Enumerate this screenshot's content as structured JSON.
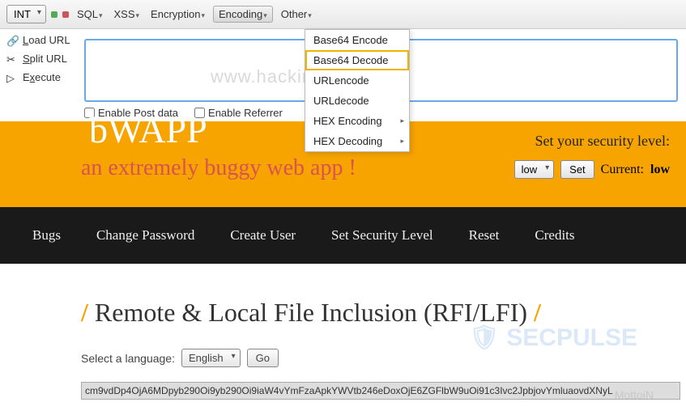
{
  "toolbar": {
    "int_label": "INT",
    "items": [
      "SQL",
      "XSS",
      "Encryption",
      "Encoding",
      "Other"
    ]
  },
  "encoding_menu": {
    "items": [
      {
        "label": "Base64 Encode",
        "submenu": false
      },
      {
        "label": "Base64 Decode",
        "submenu": false,
        "highlight": true
      },
      {
        "label": "URLencode",
        "submenu": false
      },
      {
        "label": "URLdecode",
        "submenu": false
      },
      {
        "label": "HEX Encoding",
        "submenu": true
      },
      {
        "label": "HEX Decoding",
        "submenu": true
      }
    ]
  },
  "side": {
    "load": "Load URL",
    "split": "Split URL",
    "execute": "Execute"
  },
  "checks": {
    "post": "Enable Post data",
    "referrer": "Enable Referrer"
  },
  "watermark": "www.hackingarticles.in",
  "banner": {
    "title": "bWAPP",
    "subtitle": "an extremely buggy web app !",
    "sec_label": "Set your security level:",
    "level_value": "low",
    "set_btn": "Set",
    "current_label": "Current:",
    "current_value": "low"
  },
  "nav": [
    "Bugs",
    "Change Password",
    "Create User",
    "Set Security Level",
    "Reset",
    "Credits"
  ],
  "page": {
    "title": "Remote & Local File Inclusion (RFI/LFI)",
    "lang_label": "Select a language:",
    "lang_value": "English",
    "go": "Go",
    "encoded": "cm9vdDp4OjA6MDpyb290Oi9yb290Oi9iaW4vYmFzaApkYWVtb246eDoxOjE6ZGFlbW9uOi91c3Ivc2JpbjovYmluaovdXNyL"
  },
  "bg": {
    "secpulse": "SECPULSE",
    "mottoin": "MottoiN"
  }
}
